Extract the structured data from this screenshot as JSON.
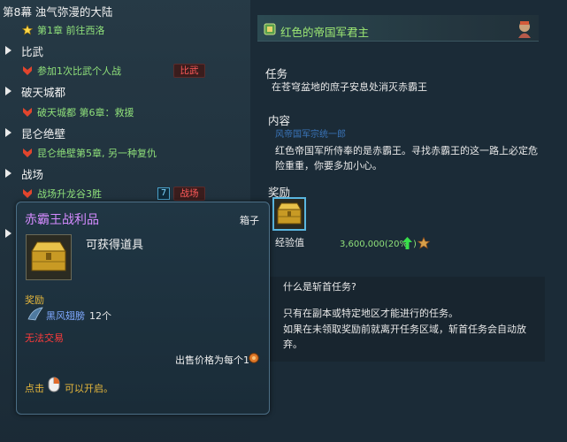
{
  "quest_list": {
    "chapter_title": "第8幕 浊气弥漫的大陆",
    "chapter_quest": "第1章 前往西洛",
    "categories": [
      {
        "name": "比武",
        "quest": "参加1次比武个人战",
        "tag": "比武"
      },
      {
        "name": "破天城都",
        "quest": "破天城都 第6章：救援"
      },
      {
        "name": "昆仑绝壁",
        "quest": "昆仑绝壁第5章, 另一种复仇"
      },
      {
        "name": "战场",
        "quest": "战场升龙谷3胜",
        "count": "7",
        "tag": "战场"
      }
    ]
  },
  "tooltip": {
    "title": "赤霸王战利品",
    "type": "箱子",
    "obtainable": "可获得道具",
    "reward_label": "奖励",
    "item_name": "黑风翅膀",
    "item_count": "12个",
    "untradable": "无法交易",
    "sell_price": "出售价格为每个1",
    "click_prefix": "点击",
    "click_suffix": "可以开启。"
  },
  "detail": {
    "quest_title": "红色的帝国军君主",
    "task_header": "任务",
    "task_text": "在苍穹盆地的庶子安息处消灭赤霸王",
    "content_header": "内容",
    "content_speaker": "风帝国军宗统一郎",
    "content_text": "红色帝国军所侍奉的是赤霸王。寻找赤霸王的这一路上必定危险重重，你要多加小心。",
    "reward_header": "奖励",
    "exp_label": "经验值",
    "exp_value": "3,600,000(20%",
    "exp_suffix": ")",
    "info_question": "什么是斩首任务?",
    "info_line1": "只有在副本或特定地区才能进行的任务。",
    "info_line2": "如果在未领取奖励前就离开任务区域，斩首任务会自动放弃。"
  },
  "colors": {
    "quest_green": "#8fe07a",
    "tooltip_title": "#d58bff",
    "untradable_red": "#ff3b3b",
    "reward_gold": "#e7b83c",
    "item_blue": "#7fa9ff"
  }
}
